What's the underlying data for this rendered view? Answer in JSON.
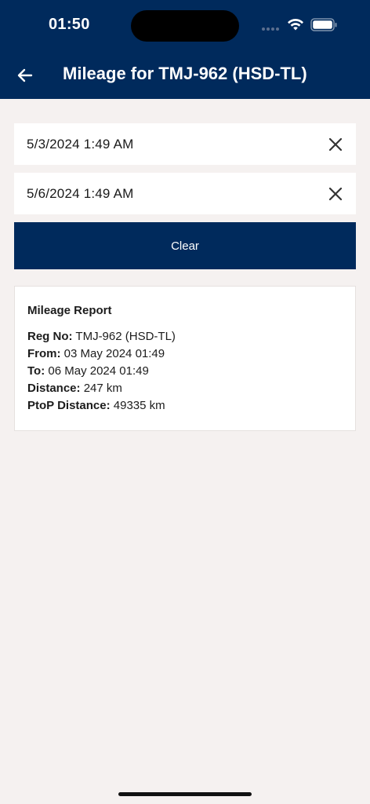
{
  "status_bar": {
    "time": "01:50"
  },
  "header": {
    "title": "Mileage for TMJ-962 (HSD-TL)"
  },
  "fields": [
    {
      "value": "5/3/2024 1:49 AM"
    },
    {
      "value": "5/6/2024 1:49 AM"
    }
  ],
  "clear_button": {
    "label": "Clear"
  },
  "report": {
    "title": "Mileage Report",
    "rows": [
      {
        "label": "Reg No:",
        "value": "TMJ-962 (HSD-TL)"
      },
      {
        "label": "From:",
        "value": "03 May 2024 01:49"
      },
      {
        "label": "To:",
        "value": "06 May 2024 01:49"
      },
      {
        "label": "Distance:",
        "value": "247 km"
      },
      {
        "label": "PtoP Distance:",
        "value": "49335 km"
      }
    ]
  },
  "colors": {
    "primary": "#002a5c",
    "background": "#f5f1f0",
    "card": "#ffffff"
  },
  "icons": [
    "back-arrow-icon",
    "wifi-icon",
    "battery-icon",
    "close-icon"
  ]
}
